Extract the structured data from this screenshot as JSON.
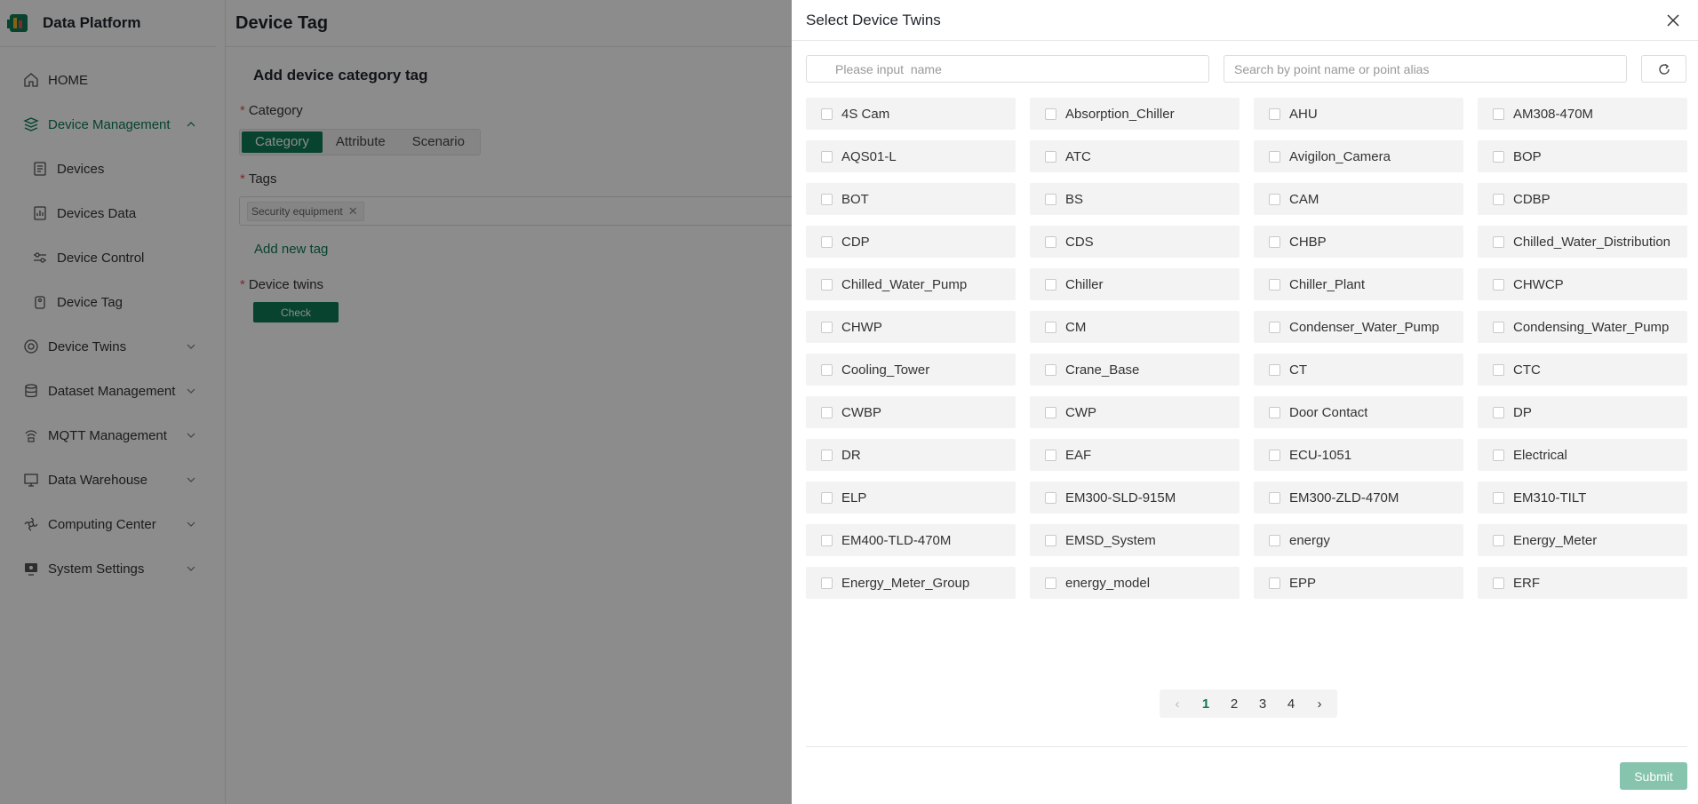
{
  "app": {
    "title": "Data Platform"
  },
  "sidebar": {
    "items": [
      {
        "label": "HOME",
        "icon": "home-icon"
      },
      {
        "label": "Device Management",
        "icon": "device-management-icon",
        "expanded": true
      },
      {
        "label": "Devices",
        "icon": "devices-icon"
      },
      {
        "label": "Devices Data",
        "icon": "devices-data-icon"
      },
      {
        "label": "Device Control",
        "icon": "device-control-icon"
      },
      {
        "label": "Device Tag",
        "icon": "device-tag-icon"
      },
      {
        "label": "Device Twins",
        "icon": "device-twins-icon"
      },
      {
        "label": "Dataset Management",
        "icon": "dataset-icon"
      },
      {
        "label": "MQTT Management",
        "icon": "mqtt-icon"
      },
      {
        "label": "Data Warehouse",
        "icon": "warehouse-icon"
      },
      {
        "label": "Computing Center",
        "icon": "computing-icon"
      },
      {
        "label": "System Settings",
        "icon": "settings-icon"
      }
    ]
  },
  "page": {
    "title": "Device Tag",
    "form_title": "Add device category tag",
    "category_label": "Category",
    "category_options": [
      "Category",
      "Attribute",
      "Scenario"
    ],
    "category_selected": "Category",
    "tags_label": "Tags",
    "tags": [
      "Security equipment"
    ],
    "add_tag_label": "Add new tag",
    "twins_label": "Device twins",
    "check_label": "Check"
  },
  "drawer": {
    "title": "Select Device Twins",
    "name_placeholder": "Please input  name",
    "point_placeholder": "Search by point name or point alias",
    "items": [
      "4S Cam",
      "Absorption_Chiller",
      "AHU",
      "AM308-470M",
      "AQS01-L",
      "ATC",
      "Avigilon_Camera",
      "BOP",
      "BOT",
      "BS",
      "CAM",
      "CDBP",
      "CDP",
      "CDS",
      "CHBP",
      "Chilled_Water_Distribution",
      "Chilled_Water_Pump",
      "Chiller",
      "Chiller_Plant",
      "CHWCP",
      "CHWP",
      "CM",
      "Condenser_Water_Pump",
      "Condensing_Water_Pump",
      "Cooling_Tower",
      "Crane_Base",
      "CT",
      "CTC",
      "CWBP",
      "CWP",
      "Door Contact",
      "DP",
      "DR",
      "EAF",
      "ECU-1051",
      "Electrical",
      "ELP",
      "EM300-SLD-915M",
      "EM300-ZLD-470M",
      "EM310-TILT",
      "EM400-TLD-470M",
      "EMSD_System",
      "energy",
      "Energy_Meter",
      "Energy_Meter_Group",
      "energy_model",
      "EPP",
      "ERF"
    ],
    "pagination": {
      "pages": [
        "1",
        "2",
        "3",
        "4"
      ],
      "current": "1"
    },
    "submit_label": "Submit"
  },
  "colors": {
    "accent": "#0d7a55",
    "submit_disabled": "#86c4ae",
    "cell_bg": "#f3f3f3"
  }
}
